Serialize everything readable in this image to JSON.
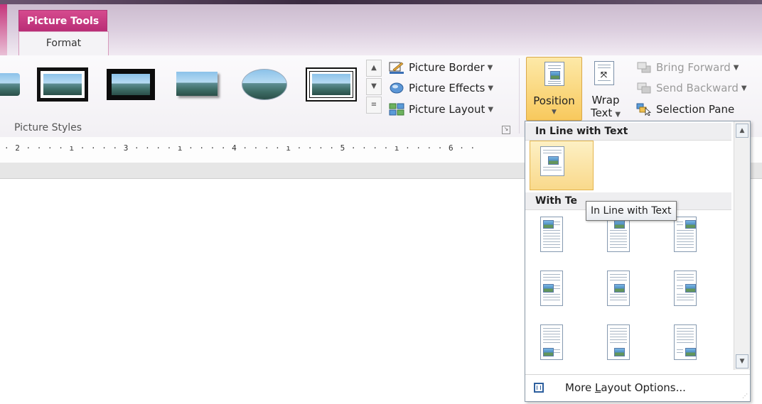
{
  "context_tab": {
    "title": "Picture Tools",
    "tab_label": "Format"
  },
  "ribbon": {
    "picture_styles": {
      "group_label": "Picture Styles",
      "picture_border": "Picture Border",
      "picture_effects": "Picture Effects",
      "picture_layout": "Picture Layout"
    },
    "arrange": {
      "position_label": "Position",
      "wrap_line1": "Wrap",
      "wrap_line2": "Text",
      "bring_forward": "Bring Forward",
      "send_backward": "Send Backward",
      "selection_pane": "Selection Pane"
    }
  },
  "ruler": {
    "text": "· 2 · · · · ı · · · · 3 · · · · ı · · · · 4 · · · · ı · · · · 5 · · · · ı · · · · 6 · ·"
  },
  "dropdown": {
    "section_inline": "In Line with Text",
    "section_wrap": "With Te",
    "tooltip": "In Line with Text",
    "more_prefix": "More ",
    "more_accel": "L",
    "more_suffix": "ayout Options..."
  },
  "icons": [
    "picture-border-icon",
    "picture-effects-icon",
    "picture-layout-icon",
    "bring-forward-icon",
    "send-backward-icon",
    "selection-pane-icon",
    "more-layout-options-icon"
  ],
  "colors": {
    "context_tab": "#c03a7f",
    "position_highlight": "#f8c95d",
    "selected_option": "#f9d98b"
  }
}
